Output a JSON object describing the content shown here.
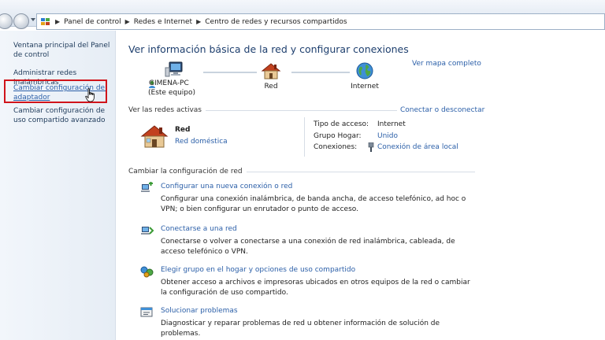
{
  "breadcrumb": {
    "items": [
      "Panel de control",
      "Redes e Internet",
      "Centro de redes y recursos compartidos"
    ]
  },
  "sidebar": {
    "items": [
      {
        "label": "Ventana principal del Panel de control"
      },
      {
        "label": "Administrar redes inalámbricas"
      },
      {
        "label": "Cambiar configuración del adaptador"
      },
      {
        "label": "Cambiar configuración de uso compartido avanzado"
      }
    ]
  },
  "main": {
    "title": "Ver información básica de la red y configurar conexiones",
    "map_link": "Ver mapa completo",
    "nodes": {
      "computer_name": "GIMENA-PC",
      "computer_sub": "(Este equipo)",
      "network": "Red",
      "internet": "Internet"
    },
    "active": {
      "label": "Ver las redes activas",
      "connect_link": "Conectar o desconectar",
      "network_name": "Red",
      "network_type": "Red doméstica",
      "access_type_key": "Tipo de acceso:",
      "access_type_val": "Internet",
      "homegroup_key": "Grupo Hogar:",
      "homegroup_val": "Unido",
      "connections_key": "Conexiones:",
      "connections_val": "Conexión de área local"
    },
    "change": {
      "label": "Cambiar la configuración de red",
      "tasks": [
        {
          "title": "Configurar una nueva conexión o red",
          "desc": "Configurar una conexión inalámbrica, de banda ancha, de acceso telefónico, ad hoc o VPN; o bien configurar un enrutador o punto de acceso."
        },
        {
          "title": "Conectarse a una red",
          "desc": "Conectarse o volver a conectarse a una conexión de red inalámbrica, cableada, de acceso telefónico o VPN."
        },
        {
          "title": "Elegir grupo en el hogar y opciones de uso compartido",
          "desc": "Obtener acceso a archivos e impresoras ubicados en otros equipos de la red o cambiar la configuración de uso compartido."
        },
        {
          "title": "Solucionar problemas",
          "desc": "Diagnosticar y reparar problemas de red u obtener información de solución de problemas."
        }
      ]
    }
  },
  "colors": {
    "link": "#2b5fa8",
    "title": "#1e3f6e",
    "highlight_box": "#d0141b"
  }
}
